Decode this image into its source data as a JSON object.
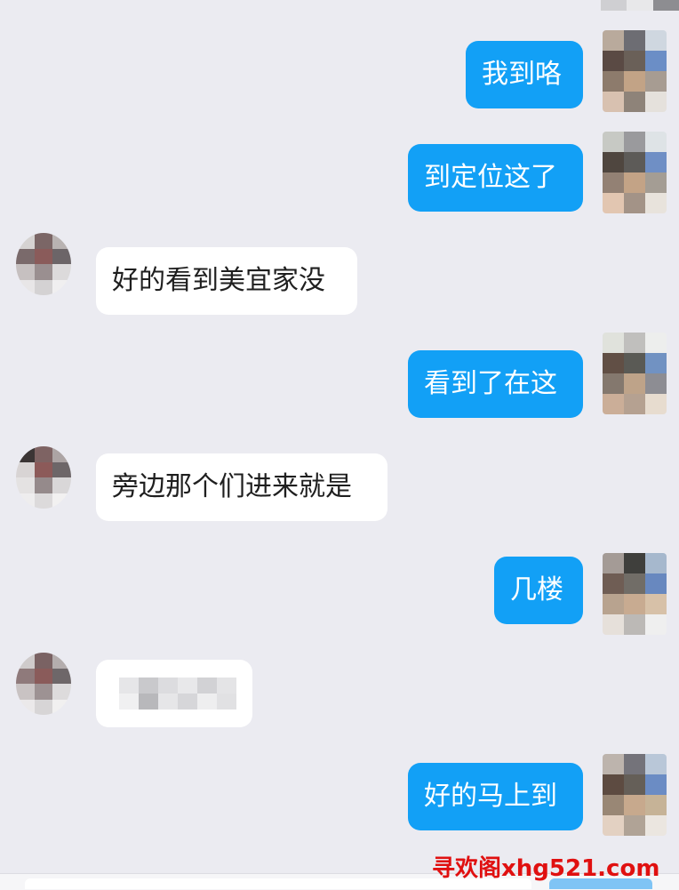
{
  "messages": [
    {
      "side": "out",
      "text": "我到咯"
    },
    {
      "side": "out",
      "text": "到定位这了"
    },
    {
      "side": "in",
      "text": "好的看到美宜家没"
    },
    {
      "side": "out",
      "text": "看到了在这"
    },
    {
      "side": "in",
      "text": "旁边那个们进来就是"
    },
    {
      "side": "out",
      "text": "几楼"
    },
    {
      "side": "in",
      "text": ""
    },
    {
      "side": "out",
      "text": "好的马上到"
    }
  ],
  "watermark": "寻欢阁xhg521.com",
  "colors": {
    "background": "#ebebf1",
    "outgoing_bubble": "#12a0f6",
    "incoming_bubble": "#ffffff",
    "watermark": "#e01010"
  }
}
